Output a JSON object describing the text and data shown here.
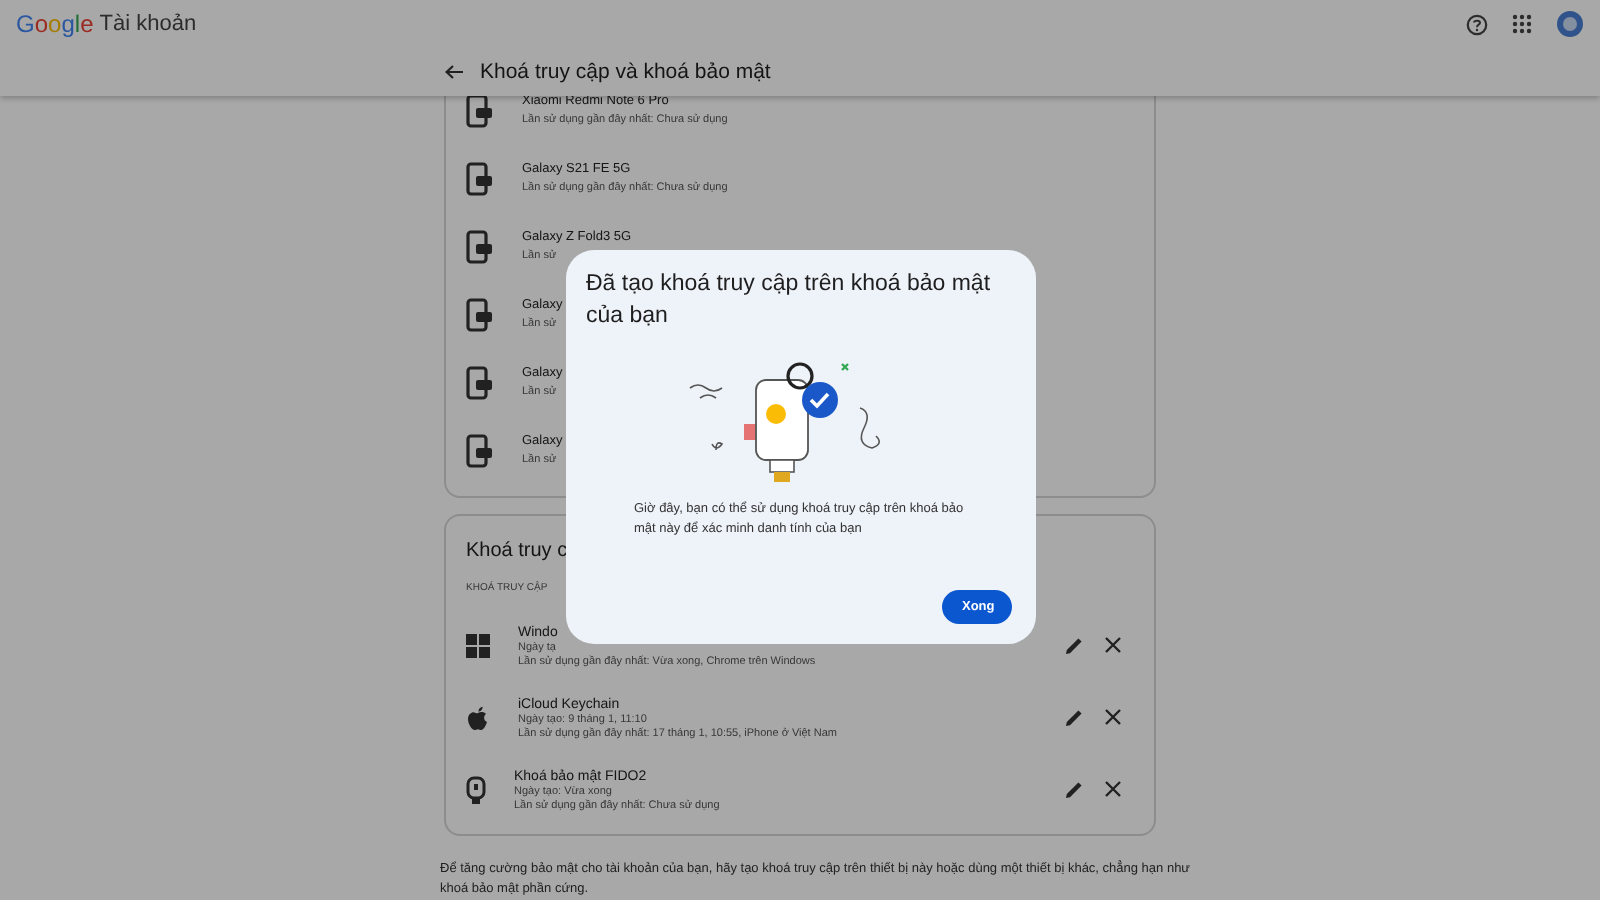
{
  "header": {
    "logo": "Google",
    "product": "Tài khoản"
  },
  "page_title": "Khoá truy cập và khoá bảo mật",
  "devices": [
    {
      "name": "Xiaomi Redmi Note 6 Pro",
      "detail": "Lần sử dụng gần đây nhất: Chưa sử dụng"
    },
    {
      "name": "Galaxy S21 FE 5G",
      "detail": "Lần sử dụng gần đây nhất: Chưa sử dụng"
    },
    {
      "name": "Galaxy Z Fold3 5G",
      "detail": "Lần sử"
    },
    {
      "name": "Galaxy",
      "detail": "Lần sử"
    },
    {
      "name": "Galaxy",
      "detail": "Lần sử"
    },
    {
      "name": "Galaxy",
      "detail": "Lần sử"
    }
  ],
  "passkeys": {
    "title": "Khoá truy c",
    "section_label": "KHOÁ TRUY CẬP",
    "items": [
      {
        "kind": "windows",
        "name": "Windo",
        "created": "Ngày tạ",
        "last_used": "Lần sử dụng gần đây nhất: Vừa xong, Chrome trên Windows"
      },
      {
        "kind": "apple",
        "name": "iCloud Keychain",
        "created": "Ngày tạo: 9 tháng 1, 11:10",
        "last_used": "Lần sử dụng gần đây nhất: 17 tháng 1, 10:55, iPhone ở Việt Nam"
      },
      {
        "kind": "key",
        "name": "Khoá bảo mật FIDO2",
        "created": "Ngày tạo: Vừa xong",
        "last_used": "Lần sử dụng gần đây nhất: Chưa sử dụng"
      }
    ]
  },
  "footer_text": "Để tăng cường bảo mật cho tài khoản của bạn, hãy tạo khoá truy cập trên thiết bị này hoặc dùng một thiết bị khác, chẳng hạn như khoá bảo mật phần cứng.",
  "dialog": {
    "title": "Đã tạo khoá truy cập trên khoá bảo mật của bạn",
    "body": "Giờ đây, bạn có thể sử dụng khoá truy cập trên khoá bảo mật này để xác minh danh tính của bạn",
    "button": "Xong"
  }
}
